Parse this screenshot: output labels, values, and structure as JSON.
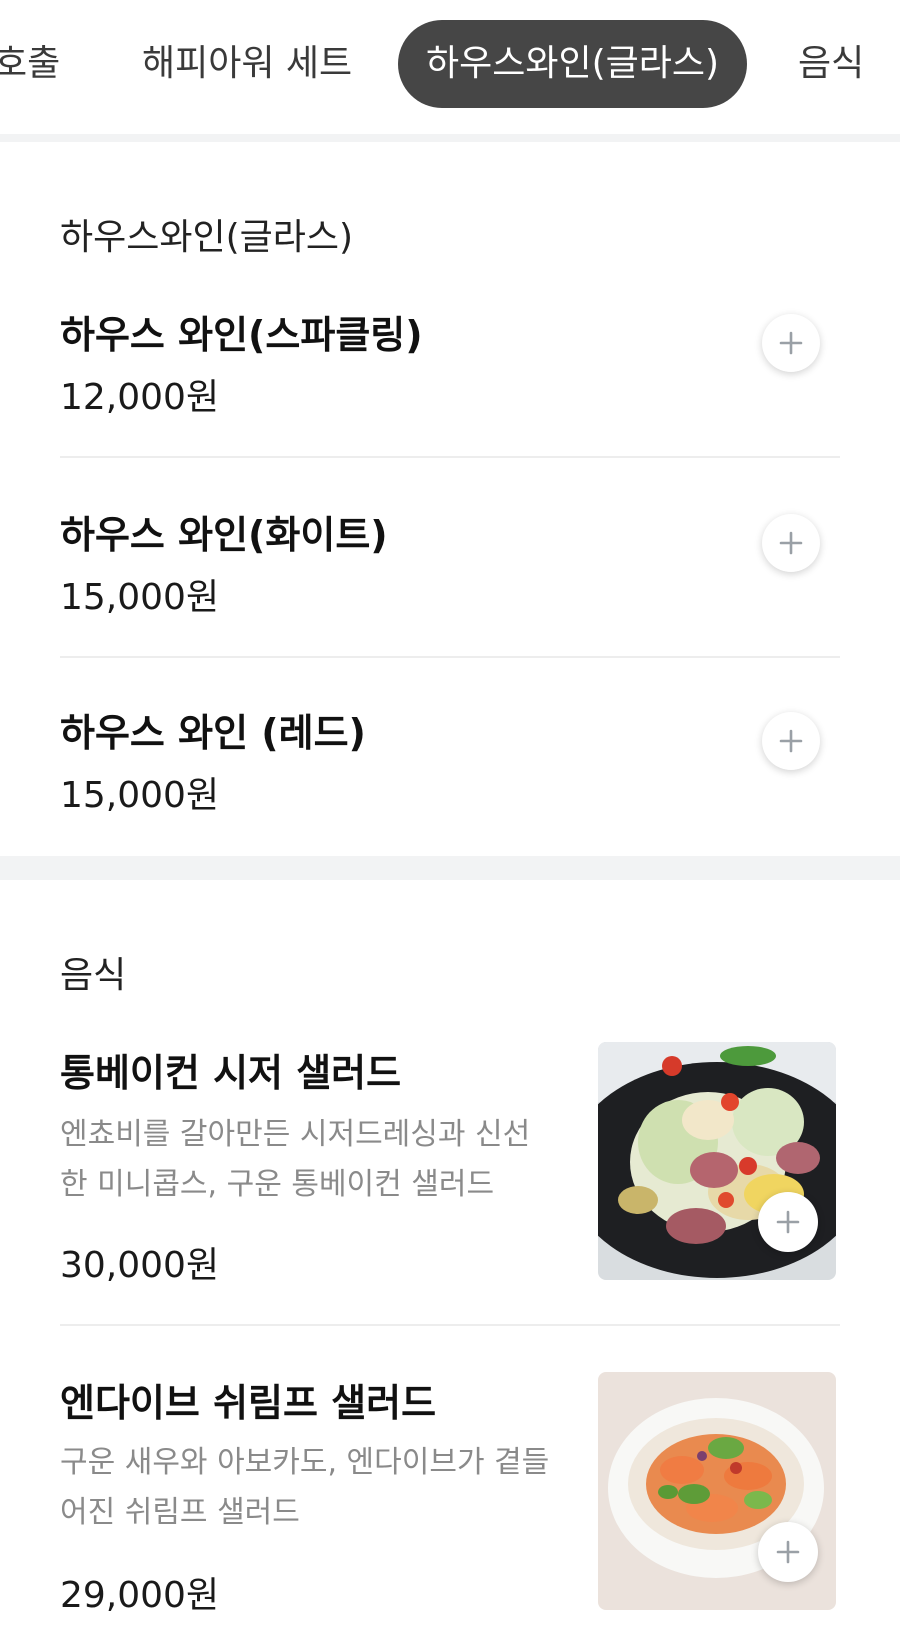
{
  "tabs": [
    {
      "label": "호출"
    },
    {
      "label": "해피아워 세트"
    },
    {
      "label": "하우스와인(글라스)",
      "active": true
    },
    {
      "label": "음식"
    }
  ],
  "wine_section": {
    "title": "하우스와인(글라스)",
    "items": [
      {
        "name": "하우스 와인(스파클링)",
        "price": "12,000원"
      },
      {
        "name": "하우스 와인(화이트)",
        "price": "15,000원"
      },
      {
        "name": "하우스 와인 (레드)",
        "price": "15,000원"
      }
    ]
  },
  "food_section": {
    "title": "음식",
    "items": [
      {
        "name": "통베이컨 시저 샐러드",
        "desc_line1": "엔쵸비를 갈아만든 시저드레싱과 신선",
        "desc_line2": "한 미니콥스, 구운 통베이컨 샐러드",
        "price": "30,000원"
      },
      {
        "name": "엔다이브 쉬림프 샐러드",
        "desc_line1": "구운 새우와 아보카도, 엔다이브가 곁들",
        "desc_line2": "어진 쉬림프 샐러드",
        "price": "29,000원"
      }
    ]
  },
  "colors": {
    "active_tab_bg": "#464646",
    "section_gap": "#f2f3f4",
    "desc_text": "#8a8a8a",
    "plus_icon": "#9aa0a6"
  }
}
